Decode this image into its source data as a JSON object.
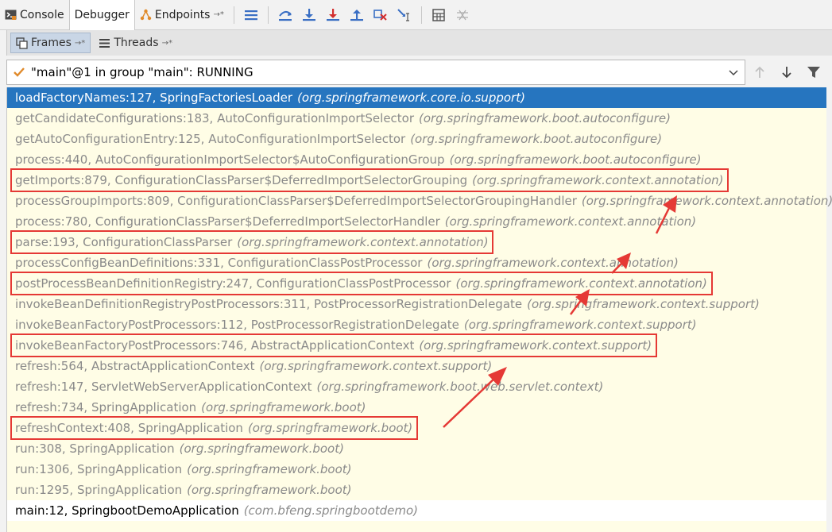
{
  "toolbar": {
    "tabs": [
      {
        "label": "Console",
        "icon": "console-icon"
      },
      {
        "label": "Debugger",
        "icon": ""
      },
      {
        "label": "Endpoints",
        "icon": "endpoints-icon"
      }
    ],
    "pin_glyph": "→*",
    "buttons": [
      "menu-icon",
      "step-over-icon",
      "step-into-icon",
      "force-step-into-icon",
      "step-out-icon",
      "drop-frame-icon",
      "run-to-cursor-icon",
      "evaluate-icon",
      "trace-icon"
    ]
  },
  "subtabs": [
    {
      "label": "Frames",
      "icon": "frames-icon"
    },
    {
      "label": "Threads",
      "icon": "threads-icon"
    }
  ],
  "thread": {
    "label": "\"main\"@1 in group \"main\": RUNNING"
  },
  "frames": [
    {
      "method": "loadFactoryNames:127, SpringFactoriesLoader",
      "pkg": "(org.springframework.core.io.support)"
    },
    {
      "method": "getCandidateConfigurations:183, AutoConfigurationImportSelector",
      "pkg": "(org.springframework.boot.autoconfigure)"
    },
    {
      "method": "getAutoConfigurationEntry:125, AutoConfigurationImportSelector",
      "pkg": "(org.springframework.boot.autoconfigure)"
    },
    {
      "method": "process:440, AutoConfigurationImportSelector$AutoConfigurationGroup",
      "pkg": "(org.springframework.boot.autoconfigure)"
    },
    {
      "method": "getImports:879, ConfigurationClassParser$DeferredImportSelectorGrouping",
      "pkg": "(org.springframework.context.annotation)"
    },
    {
      "method": "processGroupImports:809, ConfigurationClassParser$DeferredImportSelectorGroupingHandler",
      "pkg": "(org.springframework.context.annotation)"
    },
    {
      "method": "process:780, ConfigurationClassParser$DeferredImportSelectorHandler",
      "pkg": "(org.springframework.context.annotation)"
    },
    {
      "method": "parse:193, ConfigurationClassParser",
      "pkg": "(org.springframework.context.annotation)"
    },
    {
      "method": "processConfigBeanDefinitions:331, ConfigurationClassPostProcessor",
      "pkg": "(org.springframework.context.annotation)"
    },
    {
      "method": "postProcessBeanDefinitionRegistry:247, ConfigurationClassPostProcessor",
      "pkg": "(org.springframework.context.annotation)"
    },
    {
      "method": "invokeBeanDefinitionRegistryPostProcessors:311, PostProcessorRegistrationDelegate",
      "pkg": "(org.springframework.context.support)"
    },
    {
      "method": "invokeBeanFactoryPostProcessors:112, PostProcessorRegistrationDelegate",
      "pkg": "(org.springframework.context.support)"
    },
    {
      "method": "invokeBeanFactoryPostProcessors:746, AbstractApplicationContext",
      "pkg": "(org.springframework.context.support)"
    },
    {
      "method": "refresh:564, AbstractApplicationContext",
      "pkg": "(org.springframework.context.support)"
    },
    {
      "method": "refresh:147, ServletWebServerApplicationContext",
      "pkg": "(org.springframework.boot.web.servlet.context)"
    },
    {
      "method": "refresh:734, SpringApplication",
      "pkg": "(org.springframework.boot)"
    },
    {
      "method": "refreshContext:408, SpringApplication",
      "pkg": "(org.springframework.boot)"
    },
    {
      "method": "run:308, SpringApplication",
      "pkg": "(org.springframework.boot)"
    },
    {
      "method": "run:1306, SpringApplication",
      "pkg": "(org.springframework.boot)"
    },
    {
      "method": "run:1295, SpringApplication",
      "pkg": "(org.springframework.boot)"
    },
    {
      "method": "main:12, SpringbootDemoApplication",
      "pkg": "(com.bfeng.springbootdemo)"
    }
  ],
  "selected_frame_index": 0,
  "library_frame_count": 20,
  "highlighted_frames": [
    4,
    7,
    9,
    12,
    16
  ],
  "colors": {
    "selection": "#2675bf",
    "library_frame_bg": "#fffde6",
    "annotation": "#e53935"
  }
}
